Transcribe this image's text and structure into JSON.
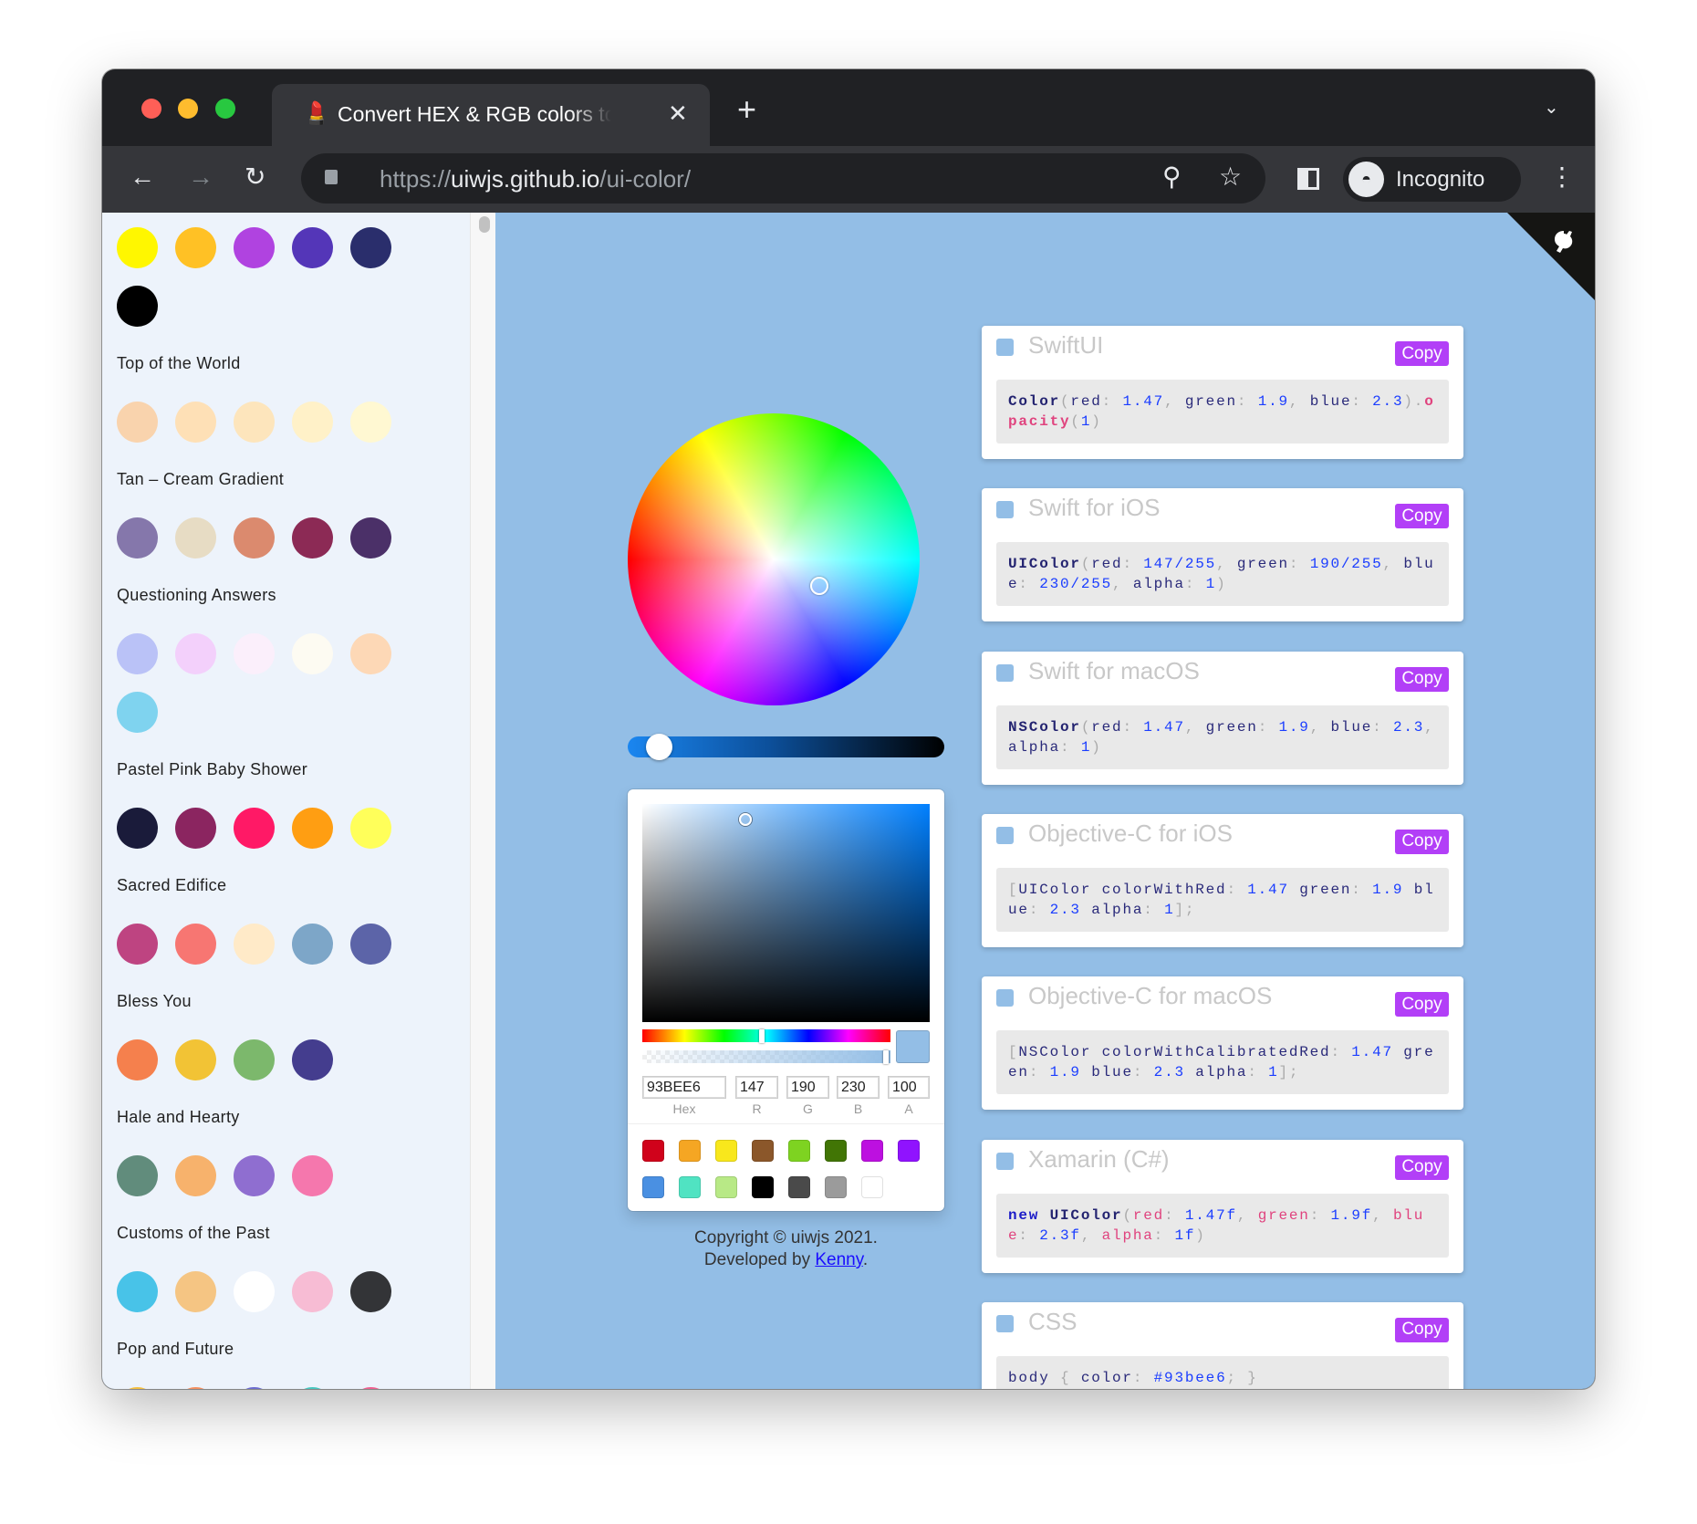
{
  "browser": {
    "tab_title": "Convert HEX & RGB colors to UIColor",
    "url_host": "uiwjs.github.io",
    "url_scheme": "https://",
    "url_path": "/ui-color/",
    "profile": "Incognito"
  },
  "sidebar": {
    "palettes": [
      {
        "colors": [
          "#FFF700",
          "#FFC125",
          "#B043E0",
          "#5436B8",
          "#2A2E6C",
          "#000000"
        ],
        "title": "Top of the World"
      },
      {
        "colors": [
          "#F9D3AD",
          "#FEE0B6",
          "#FDE5BC",
          "#FFF1C8",
          "#FFF8D2"
        ],
        "title": "Tan – Cream Gradient"
      },
      {
        "colors": [
          "#8577AB",
          "#E7DCC4",
          "#DB8A6E",
          "#8C2A55",
          "#4B3068"
        ],
        "title": "Questioning Answers"
      },
      {
        "colors": [
          "#BAC2F7",
          "#F3D0FB",
          "#FBEFFB",
          "#FDFBF2",
          "#FDD8B6",
          "#7FD3EF"
        ],
        "title": "Pastel Pink Baby Shower"
      },
      {
        "colors": [
          "#1A1B3A",
          "#8B2560",
          "#FF1966",
          "#FF9E12",
          "#FFFF5A"
        ],
        "title": "Sacred Edifice"
      },
      {
        "colors": [
          "#BE4481",
          "#F77672",
          "#FFEAC8",
          "#7DA6C8",
          "#5C64A8"
        ],
        "title": "Bless You"
      },
      {
        "colors": [
          "#F5804D",
          "#F2C335",
          "#7CB86C",
          "#443D8E"
        ],
        "title": "Hale and Hearty"
      },
      {
        "colors": [
          "#618C7C",
          "#F7B26C",
          "#8F6ED0",
          "#F577AD"
        ],
        "title": "Customs of the Past"
      },
      {
        "colors": [
          "#48C3E8",
          "#F5C583",
          "#FFFFFF",
          "#F7BCD4",
          "#333437"
        ],
        "title": "Pop and Future"
      },
      {
        "colors": [
          "#F5C040",
          "#F59060",
          "#6C6CD0",
          "#48C8C0",
          "#F06090"
        ],
        "title": ""
      }
    ]
  },
  "picker": {
    "hex": "93BEE6",
    "r": "147",
    "g": "190",
    "b": "230",
    "a": "100",
    "labels": {
      "hex": "Hex",
      "r": "R",
      "g": "G",
      "b": "B",
      "a": "A"
    },
    "current_color": "#93BEE6",
    "swatches": [
      "#D0021B",
      "#F5A623",
      "#F8E71C",
      "#8B572A",
      "#7ED321",
      "#417505",
      "#BD10E0",
      "#9013FE",
      "#4A90E2",
      "#50E3C2",
      "#B8E986",
      "#000000",
      "#4A4A4A",
      "#9B9B9B",
      "#FFFFFF"
    ]
  },
  "footer": {
    "copyright": "Copyright © uiwjs 2021.",
    "developed_by": "Developed by ",
    "author": "Kenny",
    "period": "."
  },
  "copy_label": "Copy",
  "cards": [
    {
      "title": "SwiftUI",
      "code": [
        [
          "Color",
          "kw"
        ],
        [
          "(",
          "p"
        ],
        [
          "red",
          ""
        ],
        [
          ": ",
          "p"
        ],
        [
          "1.47",
          "n"
        ],
        [
          ", ",
          "p"
        ],
        [
          "green",
          ""
        ],
        [
          ": ",
          "p"
        ],
        [
          "1.9",
          "n"
        ],
        [
          ", ",
          "p"
        ],
        [
          "blue",
          ""
        ],
        [
          ": ",
          "p"
        ],
        [
          "2.3",
          "n"
        ],
        [
          ").",
          "p"
        ],
        [
          "opacity",
          "pkb"
        ],
        [
          "(",
          "p"
        ],
        [
          "1",
          "n"
        ],
        [
          ")",
          "p"
        ]
      ]
    },
    {
      "title": "Swift for iOS",
      "code": [
        [
          "UIColor",
          "kw"
        ],
        [
          "(",
          "p"
        ],
        [
          "red",
          ""
        ],
        [
          ": ",
          "p"
        ],
        [
          "147/255",
          "n"
        ],
        [
          ", ",
          "p"
        ],
        [
          "green",
          ""
        ],
        [
          ": ",
          "p"
        ],
        [
          "190/255",
          "n"
        ],
        [
          ", ",
          "p"
        ],
        [
          "blue",
          ""
        ],
        [
          ": ",
          "p"
        ],
        [
          "230/255",
          "n"
        ],
        [
          ", ",
          "p"
        ],
        [
          "alpha",
          ""
        ],
        [
          ": ",
          "p"
        ],
        [
          "1",
          "n"
        ],
        [
          ")",
          "p"
        ]
      ]
    },
    {
      "title": "Swift for macOS",
      "code": [
        [
          "NSColor",
          "kw"
        ],
        [
          "(",
          "p"
        ],
        [
          "red",
          ""
        ],
        [
          ": ",
          "p"
        ],
        [
          "1.47",
          "n"
        ],
        [
          ", ",
          "p"
        ],
        [
          "green",
          ""
        ],
        [
          ": ",
          "p"
        ],
        [
          "1.9",
          "n"
        ],
        [
          ", ",
          "p"
        ],
        [
          "blue",
          ""
        ],
        [
          ": ",
          "p"
        ],
        [
          "2.3",
          "n"
        ],
        [
          ", ",
          "p"
        ],
        [
          "alpha",
          ""
        ],
        [
          ": ",
          "p"
        ],
        [
          "1",
          "n"
        ],
        [
          ")",
          "p"
        ]
      ]
    },
    {
      "title": "Objective-C for iOS",
      "code": [
        [
          "[",
          "p"
        ],
        [
          "UIColor colorWithRed",
          ""
        ],
        [
          ": ",
          "p"
        ],
        [
          "1.47",
          "n"
        ],
        [
          " green",
          ""
        ],
        [
          ": ",
          "p"
        ],
        [
          "1.9",
          "n"
        ],
        [
          " blue",
          ""
        ],
        [
          ": ",
          "p"
        ],
        [
          "2.3",
          "n"
        ],
        [
          " alpha",
          ""
        ],
        [
          ": ",
          "p"
        ],
        [
          "1",
          "n"
        ],
        [
          "];",
          "p"
        ]
      ]
    },
    {
      "title": "Objective-C for macOS",
      "code": [
        [
          "[",
          "p"
        ],
        [
          "NSColor colorWithCalibratedRed",
          ""
        ],
        [
          ": ",
          "p"
        ],
        [
          "1.47",
          "n"
        ],
        [
          " green",
          ""
        ],
        [
          ": ",
          "p"
        ],
        [
          "1.9",
          "n"
        ],
        [
          " blue",
          ""
        ],
        [
          ": ",
          "p"
        ],
        [
          "2.3",
          "n"
        ],
        [
          " alpha",
          ""
        ],
        [
          ": ",
          "p"
        ],
        [
          "1",
          "n"
        ],
        [
          "];",
          "p"
        ]
      ]
    },
    {
      "title": "Xamarin (C#)",
      "code": [
        [
          "new",
          "kwb"
        ],
        [
          " ",
          ""
        ],
        [
          "UIColor",
          "kw"
        ],
        [
          "(",
          "p"
        ],
        [
          "red",
          "pk"
        ],
        [
          ": ",
          "p"
        ],
        [
          "1.47f",
          "n"
        ],
        [
          ", ",
          "p"
        ],
        [
          "green",
          "pk"
        ],
        [
          ": ",
          "p"
        ],
        [
          "1.9f",
          "n"
        ],
        [
          ", ",
          "p"
        ],
        [
          "blue",
          "pk"
        ],
        [
          ": ",
          "p"
        ],
        [
          "2.3f",
          "n"
        ],
        [
          ", ",
          "p"
        ],
        [
          "alpha",
          "pk"
        ],
        [
          ": ",
          "p"
        ],
        [
          "1f",
          "n"
        ],
        [
          ")",
          "p"
        ]
      ]
    },
    {
      "title": "CSS",
      "code": [
        [
          "body",
          ""
        ],
        [
          " { ",
          "p"
        ],
        [
          "color",
          ""
        ],
        [
          ": ",
          "p"
        ],
        [
          "#93bee6",
          "n"
        ],
        [
          "; }",
          "p"
        ]
      ]
    }
  ],
  "colors": {
    "accent": "#B23FF7",
    "background": "#93BEE6"
  }
}
